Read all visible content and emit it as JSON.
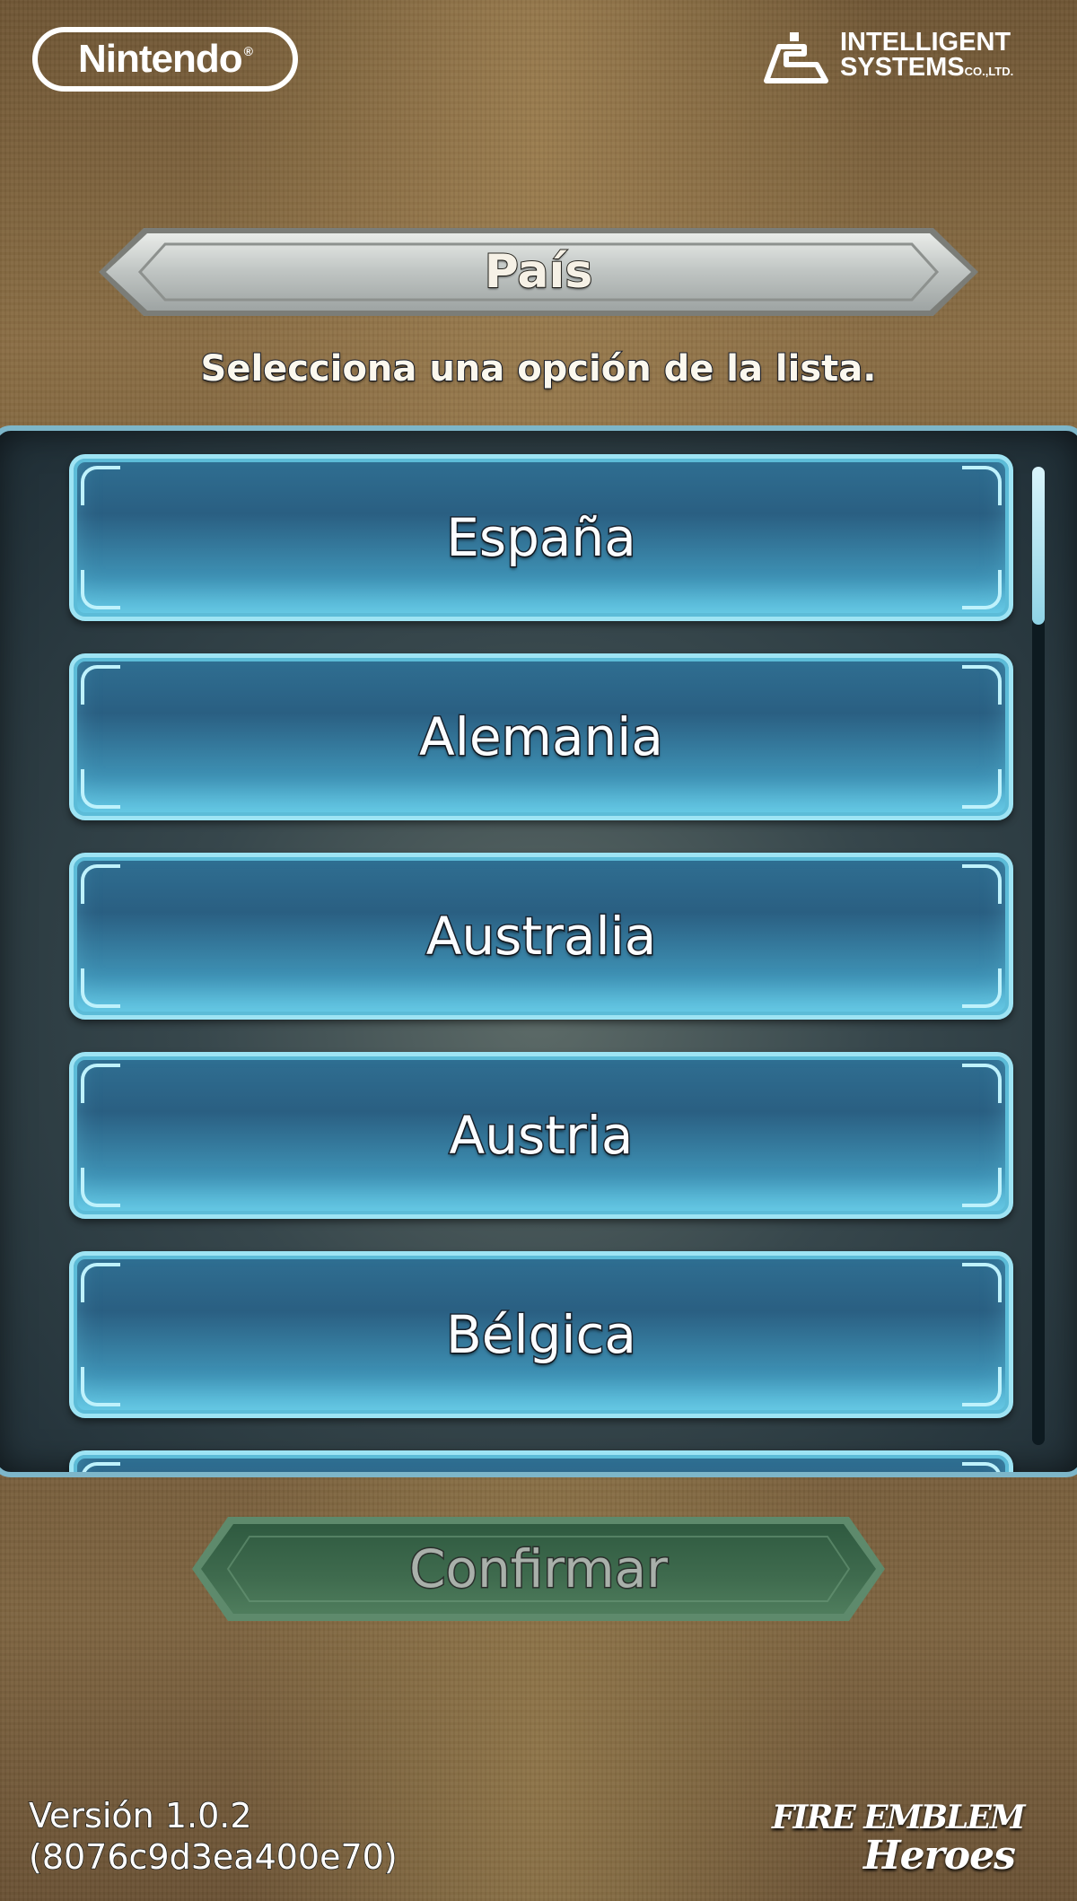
{
  "header": {
    "nintendo_logo": "Nintendo",
    "is_logo_line1": "INTELLIGENT",
    "is_logo_line2": "SYSTEMS",
    "is_logo_suffix": "CO.,LTD."
  },
  "title": "País",
  "instructions": "Selecciona una opción de la lista.",
  "countries": [
    {
      "label": "España"
    },
    {
      "label": "Alemania"
    },
    {
      "label": "Australia"
    },
    {
      "label": "Austria"
    },
    {
      "label": "Bélgica"
    }
  ],
  "confirm_label": "Confirmar",
  "confirm_enabled": false,
  "footer": {
    "version_line1": "Versión 1.0.2",
    "version_line2": "(8076c9d3ea400e70)",
    "game_logo_line1": "FIRE EMBLEM",
    "game_logo_line2": "Heroes"
  },
  "colors": {
    "list_border": "#7db6c9",
    "country_button": "#2f6f92",
    "confirm_button": "#3f6b4e"
  },
  "icons": {
    "publisher_logo": "intelligent-systems-icon"
  }
}
